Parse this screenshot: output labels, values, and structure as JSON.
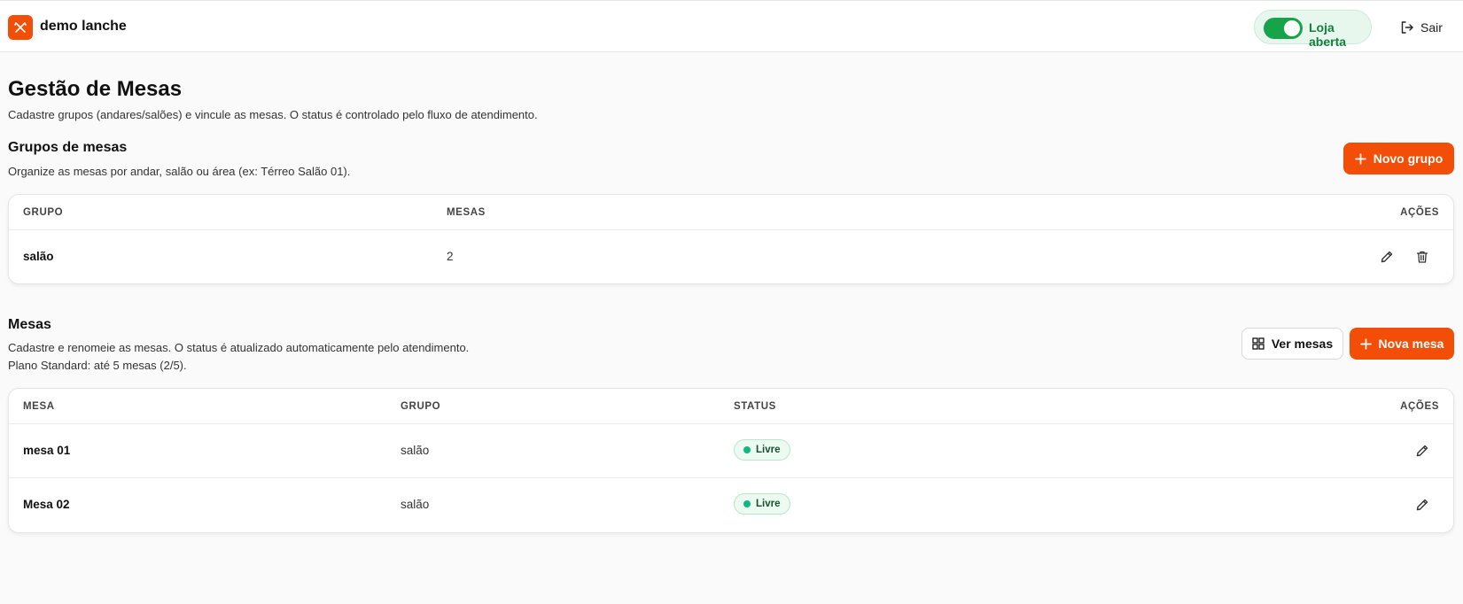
{
  "header": {
    "brand_name": "demo lanche",
    "store_status_label": "Loja aberta",
    "logout_label": "Sair"
  },
  "page": {
    "title": "Gestão de Mesas",
    "subtitle": "Cadastre grupos (andares/salões) e vincule as mesas. O status é controlado pelo fluxo de atendimento."
  },
  "groups_section": {
    "title": "Grupos de mesas",
    "subtitle": "Organize as mesas por andar, salão ou área (ex: Térreo Salão 01).",
    "new_button": "Novo grupo",
    "columns": {
      "group": "GRUPO",
      "tables": "MESAS",
      "actions": "AÇÕES"
    },
    "rows": [
      {
        "name": "salão",
        "tables": "2"
      }
    ]
  },
  "tables_section": {
    "title": "Mesas",
    "subtitle": "Cadastre e renomeie as mesas. O status é atualizado automaticamente pelo atendimento.",
    "plan_info": "Plano Standard: até 5 mesas (2/5).",
    "view_button": "Ver mesas",
    "new_button": "Nova mesa",
    "columns": {
      "table": "MESA",
      "group": "GRUPO",
      "status": "STATUS",
      "actions": "AÇÕES"
    },
    "rows": [
      {
        "name": "mesa 01",
        "group": "salão",
        "status": "Livre"
      },
      {
        "name": "Mesa 02",
        "group": "salão",
        "status": "Livre"
      }
    ]
  },
  "colors": {
    "accent": "#f24e07",
    "toggle_on": "#16a34a",
    "status_free_dot": "#10b981"
  },
  "icons": {
    "brand": "utensils-icon",
    "logout": "logout-icon",
    "plus": "plus-icon",
    "grid": "grid-icon",
    "edit": "pencil-icon",
    "delete": "trash-icon"
  }
}
